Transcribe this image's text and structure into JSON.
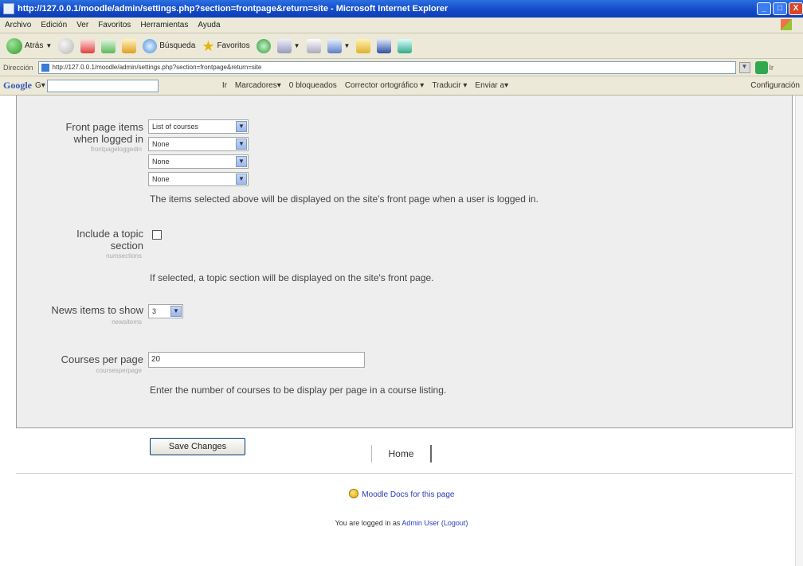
{
  "window": {
    "title": "http://127.0.0.1/moodle/admin/settings.php?section=frontpage&return=site - Microsoft Internet Explorer",
    "min": "_",
    "max": "□",
    "close": "X"
  },
  "menubar": [
    "Archivo",
    "Edición",
    "Ver",
    "Favoritos",
    "Herramientas",
    "Ayuda"
  ],
  "toolbar": {
    "back_label": "Atrás",
    "search_label": "Búsqueda",
    "favorites_label": "Favoritos"
  },
  "address": {
    "label": "Dirección",
    "url": "http://127.0.0.1/moodle/admin/settings.php?section=frontpage&return=site",
    "go": "Ir"
  },
  "googlebar": {
    "logo": "Google",
    "prefix": "G▾",
    "ir": "Ir",
    "marcadores": "Marcadores▾",
    "bloqueados": "0 bloqueados",
    "corrector": "Corrector ortográfico ▾",
    "traducir": "Traducir ▾",
    "enviar": "Enviar a▾",
    "config": "Configuración"
  },
  "settings": {
    "frontpage_logged": {
      "label_line1": "Front page items",
      "label_line2": "when logged in",
      "sublabel": "frontpageloggedin",
      "selects": [
        "List of courses",
        "None",
        "None",
        "None"
      ],
      "description": "The items selected above will be displayed on the site's front page when a user is logged in."
    },
    "topic_section": {
      "label_line1": "Include a topic",
      "label_line2": "section",
      "sublabel": "numsections",
      "checked": false,
      "description": "If selected, a topic section will be displayed on the site's front page."
    },
    "news_items": {
      "label": "News items to show",
      "sublabel": "newsitems",
      "value": "3"
    },
    "courses_per_page": {
      "label": "Courses per page",
      "sublabel": "coursesperpage",
      "value": "20",
      "description": "Enter the number of courses to be display per page in a course listing."
    }
  },
  "save_button": "Save Changes",
  "footer": {
    "docs_link": "Moodle Docs for this page",
    "logged_in_prefix": "You are logged in as",
    "user_link": "Admin User",
    "logout_link": "(Logout)",
    "home": "Home"
  }
}
